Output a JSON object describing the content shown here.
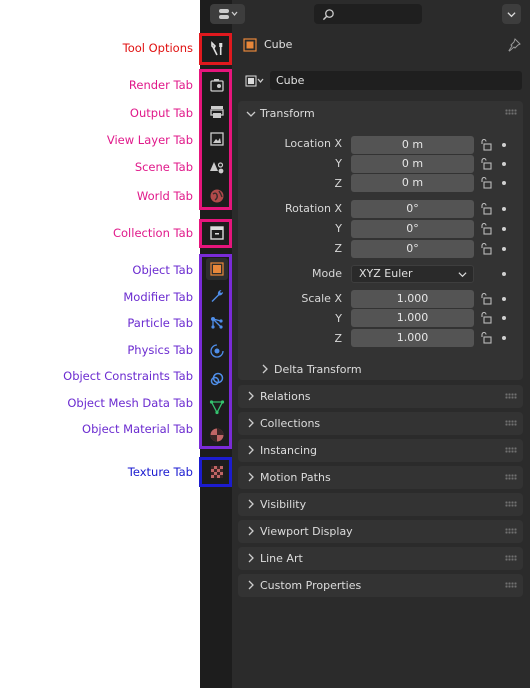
{
  "labels": {
    "tool_options": "Tool Options",
    "render": "Render Tab",
    "output": "Output Tab",
    "view_layer": "View Layer Tab",
    "scene": "Scene Tab",
    "world": "World Tab",
    "collection": "Collection Tab",
    "object": "Object Tab",
    "modifier": "Modifier Tab",
    "particle": "Particle Tab",
    "physics": "Physics Tab",
    "constraints": "Object Constraints Tab",
    "mesh_data": "Object Mesh Data Tab",
    "material": "Object Material Tab",
    "texture": "Texture Tab"
  },
  "colors": {
    "tool_box": "#e0191e",
    "pink_group": "#e6157c",
    "purple_group": "#7a2bd8",
    "blue_group": "#1c1ccf",
    "label_pink": "#e0198a",
    "label_purple": "#6b2bd0",
    "label_red": "#e01010",
    "label_blue": "#1a1ad0"
  },
  "header": {
    "object_name": "Cube",
    "datablock_name": "Cube",
    "search_placeholder": ""
  },
  "transform": {
    "title": "Transform",
    "location": {
      "label": "Location X",
      "y_label": "Y",
      "z_label": "Z",
      "x": "0 m",
      "y": "0 m",
      "z": "0 m"
    },
    "rotation": {
      "label": "Rotation X",
      "y_label": "Y",
      "z_label": "Z",
      "x": "0°",
      "y": "0°",
      "z": "0°"
    },
    "mode": {
      "label": "Mode",
      "value": "XYZ Euler"
    },
    "scale": {
      "label": "Scale X",
      "y_label": "Y",
      "z_label": "Z",
      "x": "1.000",
      "y": "1.000",
      "z": "1.000"
    },
    "delta": "Delta Transform"
  },
  "sections": [
    "Relations",
    "Collections",
    "Instancing",
    "Motion Paths",
    "Visibility",
    "Viewport Display",
    "Line Art",
    "Custom Properties"
  ],
  "icons": {
    "tool": "wrench-screwdriver-icon",
    "render": "camera-back-icon",
    "output": "printer-icon",
    "view_layer": "image-stack-icon",
    "scene": "cone-sphere-icon",
    "world": "globe-icon",
    "collection": "collection-box-icon",
    "object": "cube-square-icon",
    "modifier": "wrench-icon",
    "particle": "particles-icon",
    "physics": "orbit-icon",
    "constraints": "constraint-icon",
    "mesh": "triangle-vertex-icon",
    "material": "material-sphere-icon",
    "texture": "checker-icon"
  }
}
